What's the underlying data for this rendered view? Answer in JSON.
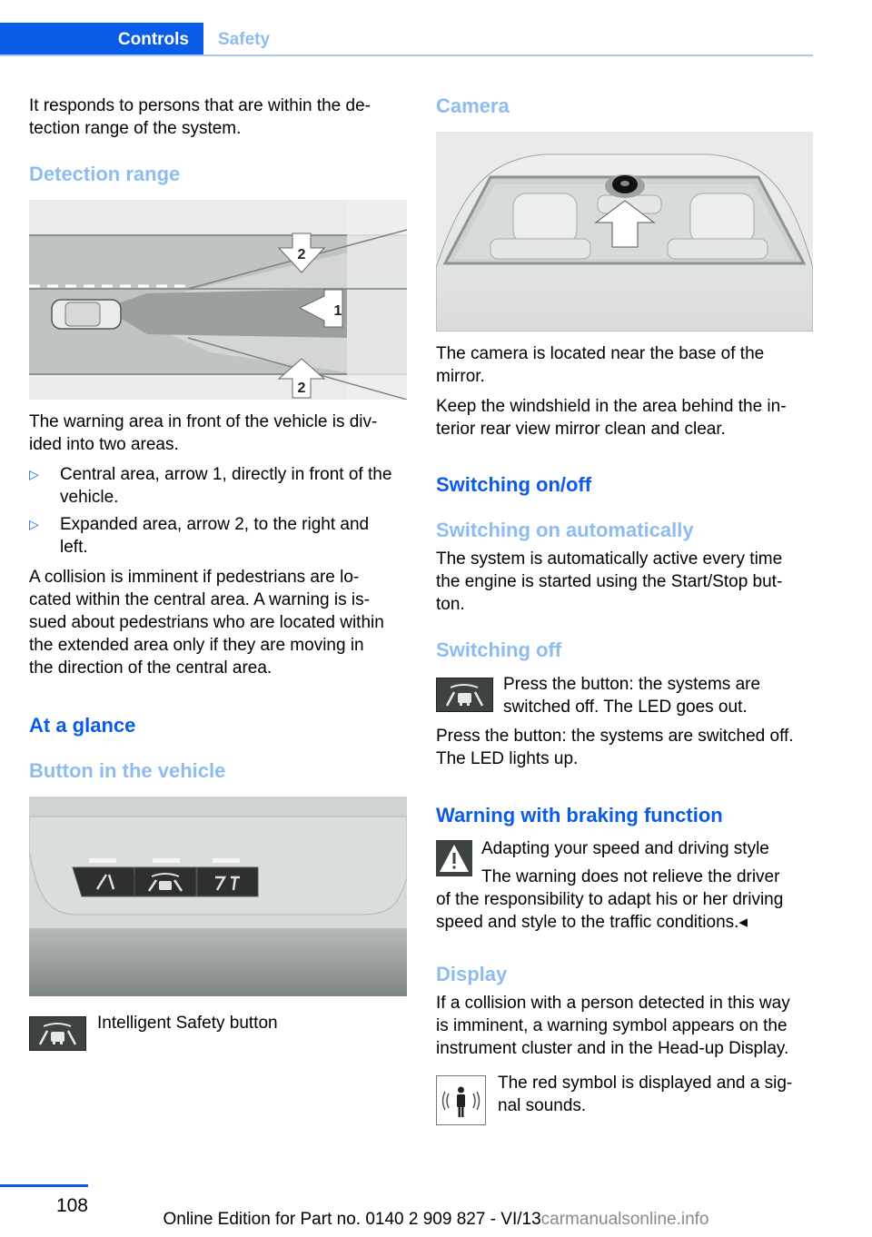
{
  "header": {
    "tab_active": "Controls",
    "tab_inactive": "Safety"
  },
  "left": {
    "intro": "It responds to persons that are within the de-tection range of the system.",
    "intro_l1": "It responds to persons that are within the de-",
    "intro_l2": "tection range of the system.",
    "detection_heading": "Detection range",
    "detection_figure": {
      "label_center_arrow": "1",
      "label_top_arrow": "2",
      "label_bottom_arrow": "2"
    },
    "warning_l1": "The warning area in front of the vehicle is div-",
    "warning_l2": "ided into two areas.",
    "bullets": [
      {
        "marker": "▷",
        "l1": "Central area, arrow 1, directly in front of the",
        "l2": "vehicle."
      },
      {
        "marker": "▷",
        "l1": "Expanded area, arrow 2, to the right and",
        "l2": "left."
      }
    ],
    "collision_lines": [
      "A collision is imminent if pedestrians are lo-",
      "cated within the central area. A warning is is-",
      "sued about pedestrians who are located within",
      "the extended area only if they are moving in",
      "the direction of the central area."
    ],
    "glance_heading": "At a glance",
    "button_heading": "Button in the vehicle",
    "button_caption": "Intelligent Safety button",
    "icon_name": "intelligent-safety-icon"
  },
  "right": {
    "camera_heading": "Camera",
    "camera_l1": "The camera is located near the base of the",
    "camera_l2": "mirror.",
    "windshield_l1": "Keep the windshield in the area behind the in-",
    "windshield_l2": "terior rear view mirror clean and clear.",
    "switching_heading": "Switching on/off",
    "auto_heading": "Switching on automatically",
    "auto_lines": [
      "The system is automatically active every time",
      "the engine is started using the Start/Stop but-",
      "ton."
    ],
    "off_heading": "Switching off",
    "off_icon_l1": "Press the button: the systems are",
    "off_icon_l2": "switched off. The LED goes out.",
    "off_l1": "Press the button: the systems are switched off.",
    "off_l2": "The LED lights up.",
    "braking_heading": "Warning with braking function",
    "braking_title": "Adapting your speed and driving style",
    "braking_l1": "The warning does not relieve the driver",
    "braking_l2": "of the responsibility to adapt his or her driving",
    "braking_l3": "speed and style to the traffic conditions.◂",
    "display_heading": "Display",
    "display_lines": [
      "If a collision with a person detected in this way",
      "is imminent, a warning symbol appears on the",
      "instrument cluster and in the Head-up Display."
    ],
    "symbol_l1": "The red symbol is displayed and a sig-",
    "symbol_l2": "nal sounds."
  },
  "footer": {
    "page_number": "108",
    "edition": "Online Edition for Part no. 0140 2 909 827 - VI/13",
    "watermark": "carmanualsonline.info"
  },
  "colors": {
    "accent": "#0a5be8",
    "accent_light": "#8dbcf0"
  }
}
